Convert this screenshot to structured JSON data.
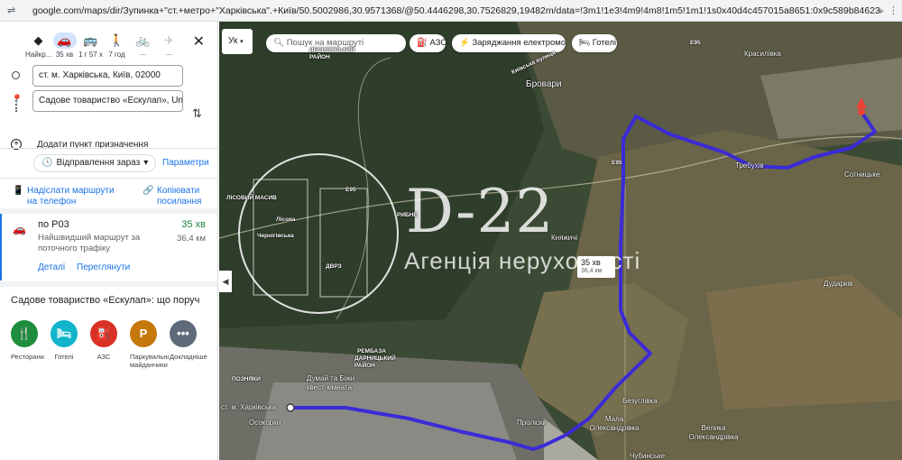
{
  "browser": {
    "url": "google.com/maps/dir/Зупинка+\"ст.+метро+\"Харківська\".+Київ/50.5002986,30.9571368/@50.4446298,30.7526829,19482m/data=!3m1!1e3!4m9!4m8!1m5!1m1!1s0x40d4c457015a8651:0x9c589b84623254aa!2m2!1d30.65247!2d50.401402!1m0!3e..."
  },
  "panel": {
    "modes": [
      {
        "name": "recommended",
        "icon": "◆",
        "label": "Найкр..."
      },
      {
        "name": "driving",
        "icon": "🚗",
        "label": "35 хв"
      },
      {
        "name": "transit",
        "icon": "🚌",
        "label": "1 г 57 х"
      },
      {
        "name": "walking",
        "icon": "🚶",
        "label": "7 год"
      },
      {
        "name": "cycling",
        "icon": "🚲",
        "label": "—"
      },
      {
        "name": "flight",
        "icon": "✈",
        "label": "—"
      }
    ],
    "close_icon": "✕",
    "origin": "ст. м. Харківська, Київ, 02000",
    "destination": "Садове товариство «Ескулап», Unnamed Road, Київська обл.",
    "add_destination": "Додати пункт призначення",
    "depart_now": "Відправлення зараз",
    "params": "Параметри",
    "send_to_phone": "Надіслати маршрути на телефон",
    "copy_link": "Копіювати посилання",
    "route": {
      "name": "по Р03",
      "time": "35 хв",
      "desc": "Найшвидший маршрут за поточного трафіку",
      "distance": "36,4 км",
      "details": "Деталі",
      "preview": "Переглянути"
    },
    "nearby_title": "Садове товариство «Ескулап»: що поруч",
    "categories": [
      {
        "label": "Ресторани",
        "icon": "🍴",
        "color": "#1e8e3e"
      },
      {
        "label": "Готелі",
        "icon": "🛏",
        "color": "#12b5cb"
      },
      {
        "label": "АЗС",
        "icon": "⛽",
        "color": "#d93025"
      },
      {
        "label": "Паркувальні майданчики",
        "icon": "P",
        "color": "#c5780c"
      },
      {
        "label": "Докладніше",
        "icon": "•••",
        "color": "#5f6b7a"
      }
    ]
  },
  "map": {
    "lang_button": "Ук",
    "search_placeholder": "Пошук на маршруті",
    "chips": [
      "АЗС",
      "Заряджання електромобілів",
      "Готелі"
    ],
    "route_color": "#3b2bd6",
    "watermark_title": "D-22",
    "watermark_subtitle": "Агенція нерухомості",
    "watermark_badge": "ДВРЗ",
    "callout_time": "35 хв",
    "callout_dist": "36,4 км",
    "labels": {
      "brovary": "Бровари",
      "krasylivka": "Красилівка",
      "trebukhiv": "Требухів",
      "sotnytske": "Сотницьке",
      "knyazhychi": "Княжичі",
      "darky": "Дударків",
      "bezuhlivka": "Безуглівка",
      "mala_oleksandrivka": "Мала Олександрівка",
      "velyka_oleksandrivka": "Велика Олександрівка",
      "proliski": "Проліски",
      "chubynske": "Чубинське",
      "kharkivska": "ст. м. Харківська",
      "osokorky": "Осокорки",
      "pozniaky": "ПОЗНЯКИ",
      "dumay": "Думай та Біжи квест-кімната",
      "lisovyi": "ЛІСОВИЙ МАСИВ",
      "lisova": "Лісова",
      "chernihivska": "Чернігівська",
      "ryb": "РИБНЕ",
      "remb": "РЕМБАЗА",
      "darnytskyi": "ДАРНИЦЬКИЙ РАЙОН",
      "desn": "ДЕСНЯНСЬКИЙ РАЙОН",
      "kyivska": "Київська вулиця",
      "e95a": "E95",
      "e95b": "E95",
      "e95c": "E95"
    }
  }
}
